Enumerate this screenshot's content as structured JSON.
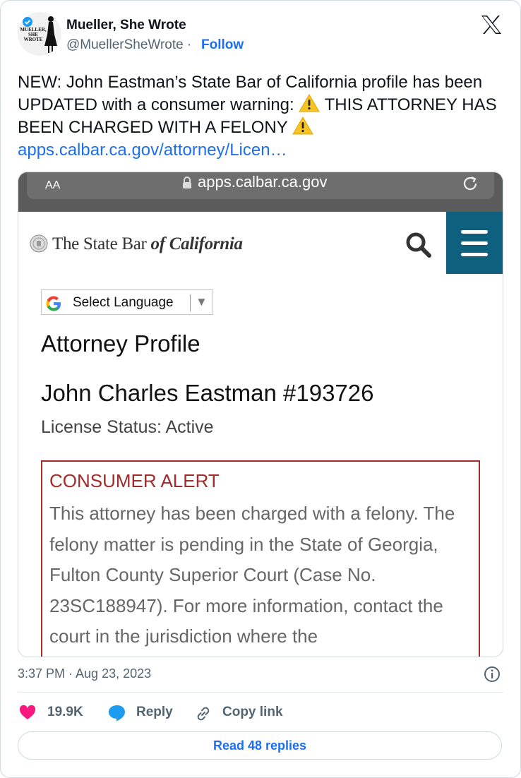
{
  "author": {
    "name": "Mueller, She Wrote",
    "handle": "@MuellerSheWrote",
    "separator": "·",
    "follow_label": "Follow",
    "avatar_text": "MUELLER, SHE WROTE"
  },
  "tweet": {
    "text_part1": "NEW: John Eastman’s State Bar of California profile has been UPDATED with a consumer warning: ",
    "text_part2": " THIS ATTORNEY HAS BEEN CHARGED WITH A FELONY ",
    "link_text": "apps.calbar.ca.gov/attorney/Licen…",
    "emoji": "warning-emoji"
  },
  "screenshot": {
    "text_size_label": "AA",
    "url": "apps.calbar.ca.gov",
    "site_logo_main": "The State Bar ",
    "site_logo_italic": "of California",
    "language_select": "Select Language",
    "language_arrow": "▼",
    "page_title": "Attorney Profile",
    "attorney_name": "John Charles Eastman #193726",
    "license_status": "License Status: Active",
    "alert_title": "CONSUMER ALERT",
    "alert_body": "This attorney has been charged with a felony. The felony matter is pending in the State of Georgia, Fulton County Superior Court (Case No. 23SC188947). For more information, contact the court in the jurisdiction where the",
    "alert_color": "#a52a2a",
    "menu_color": "#0f5f7e"
  },
  "meta": {
    "timestamp": "3:37 PM · Aug 23, 2023"
  },
  "actions": {
    "likes": "19.9K",
    "reply_label": "Reply",
    "copy_label": "Copy link",
    "read_replies": "Read 48 replies"
  },
  "colors": {
    "link": "#1d6ff0",
    "like": "#f91880",
    "reply": "#1d9bf0"
  }
}
